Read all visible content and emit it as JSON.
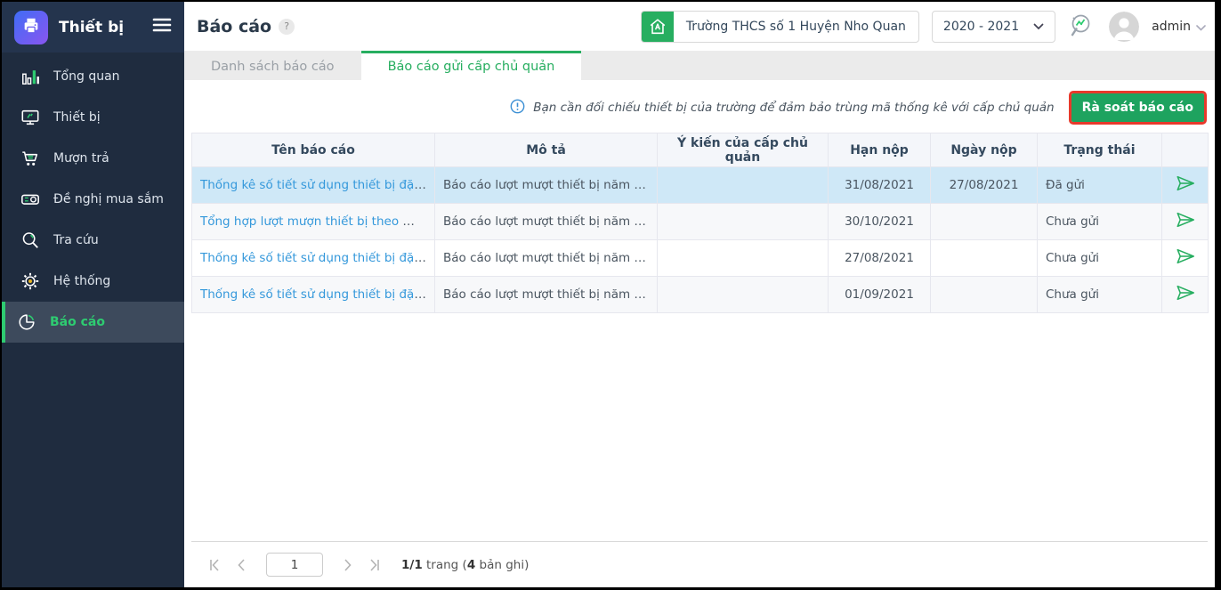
{
  "app": {
    "title": "Thiết bị"
  },
  "sidebar": {
    "items": [
      {
        "label": "Tổng quan"
      },
      {
        "label": "Thiết bị"
      },
      {
        "label": "Mượn trả"
      },
      {
        "label": "Đề nghị mua sắm"
      },
      {
        "label": "Tra cứu"
      },
      {
        "label": "Hệ thống"
      },
      {
        "label": "Báo cáo"
      }
    ]
  },
  "header": {
    "page_title": "Báo cáo",
    "help_glyph": "?",
    "school_name": "Trường THCS số 1 Huyện Nho Quan",
    "school_year": "2020 - 2021",
    "username": "admin"
  },
  "tabs": [
    {
      "label": "Danh sách báo cáo"
    },
    {
      "label": "Báo cáo gửi cấp chủ quản"
    }
  ],
  "toolbar": {
    "notice": "Bạn cần đối chiếu thiết bị của trường để đảm bảo trùng mã thống kê với cấp chủ quản",
    "review_button_label": "Rà soát báo cáo"
  },
  "table": {
    "columns": [
      "Tên báo cáo",
      "Mô tả",
      "Ý kiến của cấp chủ quản",
      "Hạn nộp",
      "Ngày nộp",
      "Trạng thái"
    ],
    "rows": [
      {
        "name": "Thống kê số tiết sử dụng thiết bị đặc thù",
        "description": "Báo cáo lượt mượt thiết bị năm học ...",
        "opinion": "",
        "deadline": "31/08/2021",
        "submitted_date": "27/08/2021",
        "status": "Đã gửi"
      },
      {
        "name": "Tổng hợp lượt mượn thiết bị theo môn h...",
        "description": "Báo cáo lượt mượt thiết bị năm học ...",
        "opinion": "",
        "deadline": "30/10/2021",
        "submitted_date": "",
        "status": "Chưa gửi"
      },
      {
        "name": "Thống kê số tiết sử dụng thiết bị đặc thù",
        "description": "Báo cáo lượt mượt thiết bị năm học ...",
        "opinion": "",
        "deadline": "27/08/2021",
        "submitted_date": "",
        "status": "Chưa gửi"
      },
      {
        "name": "Thống kê số tiết sử dụng thiết bị đặc thù",
        "description": "Báo cáo lượt mượt thiết bị năm học ...",
        "opinion": "",
        "deadline": "01/09/2021",
        "submitted_date": "",
        "status": "Chưa gửi"
      }
    ]
  },
  "pagination": {
    "page_input_value": "1",
    "page_count_bold": "1/1",
    "label_mid": " trang (",
    "records_bold": "4",
    "label_end": " bản ghi)"
  },
  "colors": {
    "accent_green": "#27ae60",
    "button_green": "#1ea35f",
    "highlight_red_border": "#e8392b",
    "link_blue": "#3498db",
    "selected_row_blue": "#cfe8f7",
    "sidebar_navy": "#1f2c3f",
    "sidebar_active": "#3d4a5c"
  }
}
